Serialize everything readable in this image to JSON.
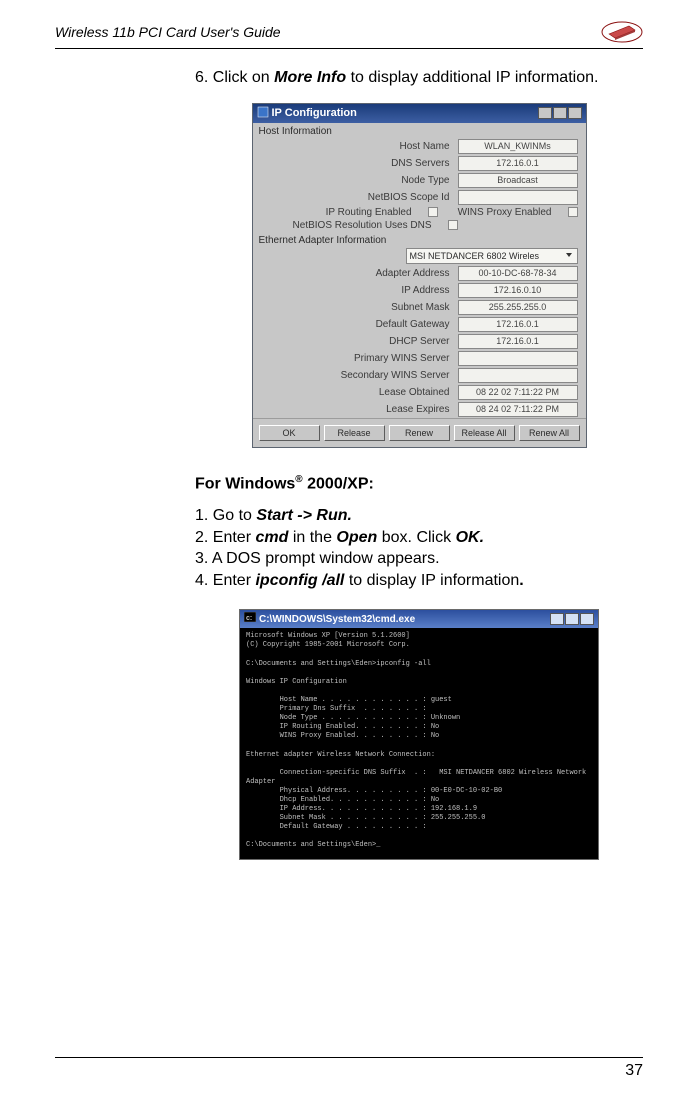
{
  "header": {
    "title": "Wireless 11b PCI Card User's Guide"
  },
  "intro_before": "6. Click on ",
  "intro_bold": "More Info",
  "intro_after": " to display additional IP information.",
  "dialog": {
    "title": "IP Configuration",
    "host_section": "Host Information",
    "rows": {
      "host_name_lbl": "Host Name",
      "host_name_val": "WLAN_KWINMs",
      "dns_lbl": "DNS Servers",
      "dns_val": "172.16.0.1",
      "node_lbl": "Node Type",
      "node_val": "Broadcast",
      "scope_lbl": "NetBIOS Scope Id",
      "routing_lbl": "IP Routing Enabled",
      "wins_proxy_lbl": "WINS Proxy Enabled",
      "netbios_lbl": "NetBIOS Resolution Uses DNS"
    },
    "adapter_section": "Ethernet Adapter Information",
    "adapter_sel": "MSI NETDANCER 6802 Wireles",
    "arows": {
      "mac_lbl": "Adapter Address",
      "mac_val": "00-10-DC-68-78-34",
      "ip_lbl": "IP Address",
      "ip_val": "172.16.0.10",
      "mask_lbl": "Subnet Mask",
      "mask_val": "255.255.255.0",
      "gw_lbl": "Default Gateway",
      "gw_val": "172.16.0.1",
      "dhcp_lbl": "DHCP Server",
      "dhcp_val": "172.16.0.1",
      "pwins_lbl": "Primary WINS Server",
      "swins_lbl": "Secondary WINS Server",
      "lease_o_lbl": "Lease Obtained",
      "lease_o_val": "08 22 02 7:11:22 PM",
      "lease_e_lbl": "Lease Expires",
      "lease_e_val": "08 24 02 7:11:22 PM"
    },
    "buttons": {
      "ok": "OK",
      "release": "Release",
      "renew": "Renew",
      "release_all": "Release All",
      "renew_all": "Renew All"
    }
  },
  "subheading_before": "For  Windows",
  "subheading_sup": "®",
  "subheading_after": " 2000/XP:",
  "steps": {
    "s1_a": "1. Go to ",
    "s1_b": "Start -> Run.",
    "s2_a": "2. Enter ",
    "s2_b": "cmd",
    "s2_c": " in the ",
    "s2_d": "Open",
    "s2_e": " box. Click ",
    "s2_f": "OK.",
    "s3": "3. A DOS prompt window appears.",
    "s4_a": "4. Enter ",
    "s4_b": "ipconfig /all",
    "s4_c": " to display IP information",
    "s4_d": "."
  },
  "cmd": {
    "title": "C:\\WINDOWS\\System32\\cmd.exe",
    "body": "Microsoft Windows XP [Version 5.1.2600]\n(C) Copyright 1985-2001 Microsoft Corp.\n\nC:\\Documents and Settings\\Eden>ipconfig -all\n\nWindows IP Configuration\n\n        Host Name . . . . . . . . . . . . : guest\n        Primary Dns Suffix  . . . . . . . :\n        Node Type . . . . . . . . . . . . : Unknown\n        IP Routing Enabled. . . . . . . . : No\n        WINS Proxy Enabled. . . . . . . . : No\n\nEthernet adapter Wireless Network Connection:\n\n        Connection-specific DNS Suffix  . :   MSI NETDANCER 6802 Wireless Network\nAdapter\n        Physical Address. . . . . . . . . : 00-E0-DC-10-02-B0\n        Dhcp Enabled. . . . . . . . . . . : No\n        IP Address. . . . . . . . . . . . : 192.168.1.9\n        Subnet Mask . . . . . . . . . . . : 255.255.255.0\n        Default Gateway . . . . . . . . . :\n\nC:\\Documents and Settings\\Eden>_"
  },
  "page_number": "37"
}
